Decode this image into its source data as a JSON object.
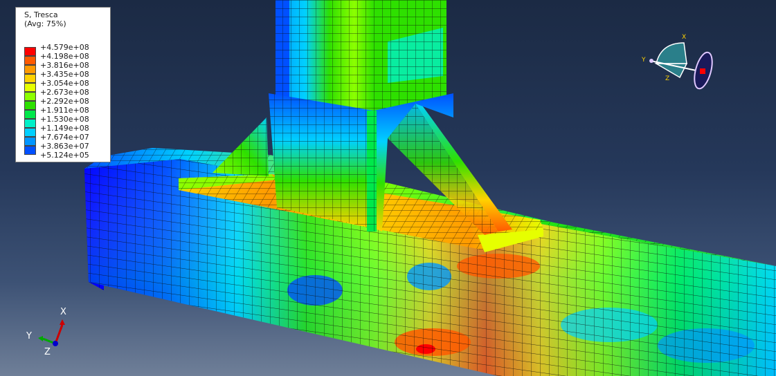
{
  "legend": {
    "title": "S, Tresca",
    "subtitle": "(Avg: 75%)",
    "entries": [
      {
        "value": "+4.579e+08",
        "color": "#ff0000"
      },
      {
        "value": "+4.198e+08",
        "color": "#ff5a00"
      },
      {
        "value": "+3.816e+08",
        "color": "#ff9a00"
      },
      {
        "value": "+3.435e+08",
        "color": "#ffd200"
      },
      {
        "value": "+3.054e+08",
        "color": "#e6ff00"
      },
      {
        "value": "+2.673e+08",
        "color": "#8cff00"
      },
      {
        "value": "+2.292e+08",
        "color": "#2ee000"
      },
      {
        "value": "+1.911e+08",
        "color": "#00e84a"
      },
      {
        "value": "+1.530e+08",
        "color": "#00f0c8"
      },
      {
        "value": "+1.149e+08",
        "color": "#00d0ff"
      },
      {
        "value": "+7.674e+07",
        "color": "#0096ff"
      },
      {
        "value": "+3.863e+07",
        "color": "#0050ff"
      },
      {
        "value": "+5.124e+05",
        "color": "#0000ff"
      }
    ]
  },
  "triad": {
    "x": "X",
    "y": "Y",
    "z": "Z"
  },
  "view_cube": {
    "x": "X",
    "y": "Y",
    "z": "Z"
  }
}
